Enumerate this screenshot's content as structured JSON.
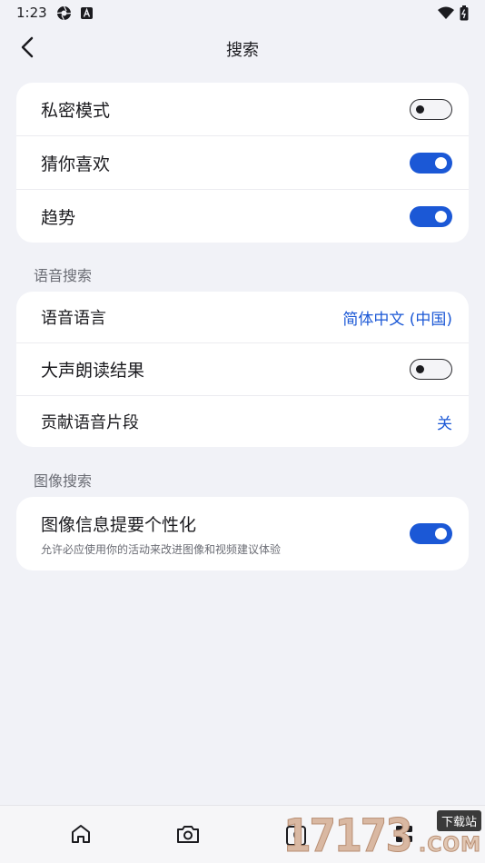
{
  "status_bar": {
    "time": "1:23"
  },
  "header": {
    "title": "搜索"
  },
  "general": {
    "items": [
      {
        "label": "私密模式",
        "toggle": "off"
      },
      {
        "label": "猜你喜欢",
        "toggle": "on"
      },
      {
        "label": "趋势",
        "toggle": "on"
      }
    ]
  },
  "voice_search": {
    "header": "语音搜索",
    "items": [
      {
        "label": "语音语言",
        "value": "简体中文 (中国)"
      },
      {
        "label": "大声朗读结果",
        "toggle": "off"
      },
      {
        "label": "贡献语音片段",
        "value": "关"
      }
    ]
  },
  "image_search": {
    "header": "图像搜索",
    "items": [
      {
        "label": "图像信息提要个性化",
        "description": "允许必应使用你的活动来改进图像和视频建议体验",
        "toggle": "on"
      }
    ]
  },
  "bottom_nav": {
    "items": [
      {
        "icon": "home-icon"
      },
      {
        "icon": "camera-icon"
      },
      {
        "icon": "tabs-icon",
        "count": "0"
      },
      {
        "icon": "apps-icon"
      }
    ]
  },
  "watermark": {
    "digits": "17173",
    "tag": "下载站",
    "domain": ".COM"
  },
  "colors": {
    "accent": "#1b58d6",
    "background": "#f1f2f7",
    "card": "#ffffff"
  }
}
